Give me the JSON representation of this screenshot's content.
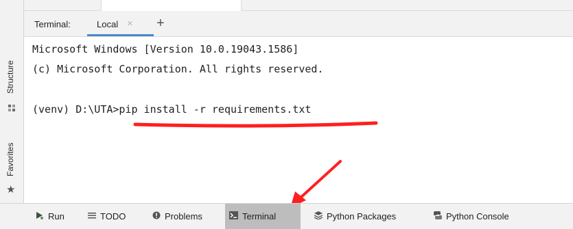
{
  "left_strip": {
    "structure_label": "Structure",
    "favorites_label": "Favorites",
    "structure_icon": "structure-icon",
    "favorites_icon": "star-icon"
  },
  "terminal": {
    "title": "Terminal:",
    "tab_label": "Local",
    "close_glyph": "×",
    "add_glyph": "+",
    "lines": [
      "Microsoft Windows [Version 10.0.19043.1586]",
      "(c) Microsoft Corporation. All rights reserved.",
      "",
      "(venv) D:\\UTA>pip install -r requirements.txt"
    ]
  },
  "annotation": {
    "color": "#ff1f1f"
  },
  "bottom_toolbar": {
    "items": [
      {
        "label": "Run",
        "icon": "run-icon"
      },
      {
        "label": "TODO",
        "icon": "todo-list-icon"
      },
      {
        "label": "Problems",
        "icon": "problems-icon"
      },
      {
        "label": "Terminal",
        "icon": "terminal-icon",
        "active": true
      },
      {
        "label": "Python Packages",
        "icon": "packages-icon"
      },
      {
        "label": "Python Console",
        "icon": "python-console-icon"
      }
    ]
  },
  "colors": {
    "accent": "#4a88c7",
    "active_tool_bg": "#bdbdbd"
  }
}
